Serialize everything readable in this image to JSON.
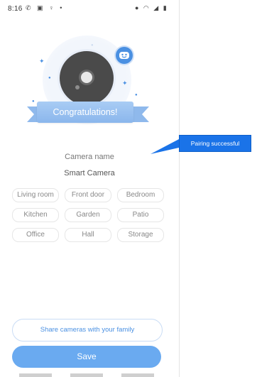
{
  "status_bar": {
    "time": "8:16",
    "left_icons": "✆ ▣ ♀ •",
    "right_icons": "● ◠ ◢ ▮"
  },
  "hero": {
    "banner_text": "Congratulations!",
    "icons": [
      "camera-icon",
      "smile-icon",
      "sparkle-icon"
    ]
  },
  "camera": {
    "label": "Camera name",
    "value": "Smart Camera"
  },
  "room_chips": [
    "Living room",
    "Front door",
    "Bedroom",
    "Kitchen",
    "Garden",
    "Patio",
    "Office",
    "Hall",
    "Storage"
  ],
  "actions": {
    "share_label": "Share cameras with your family",
    "save_label": "Save"
  },
  "callout": {
    "text": "Pairing successful"
  },
  "colors": {
    "accent": "#4a90e2",
    "save_button": "#6aaaf0",
    "callout": "#1a73e8"
  }
}
